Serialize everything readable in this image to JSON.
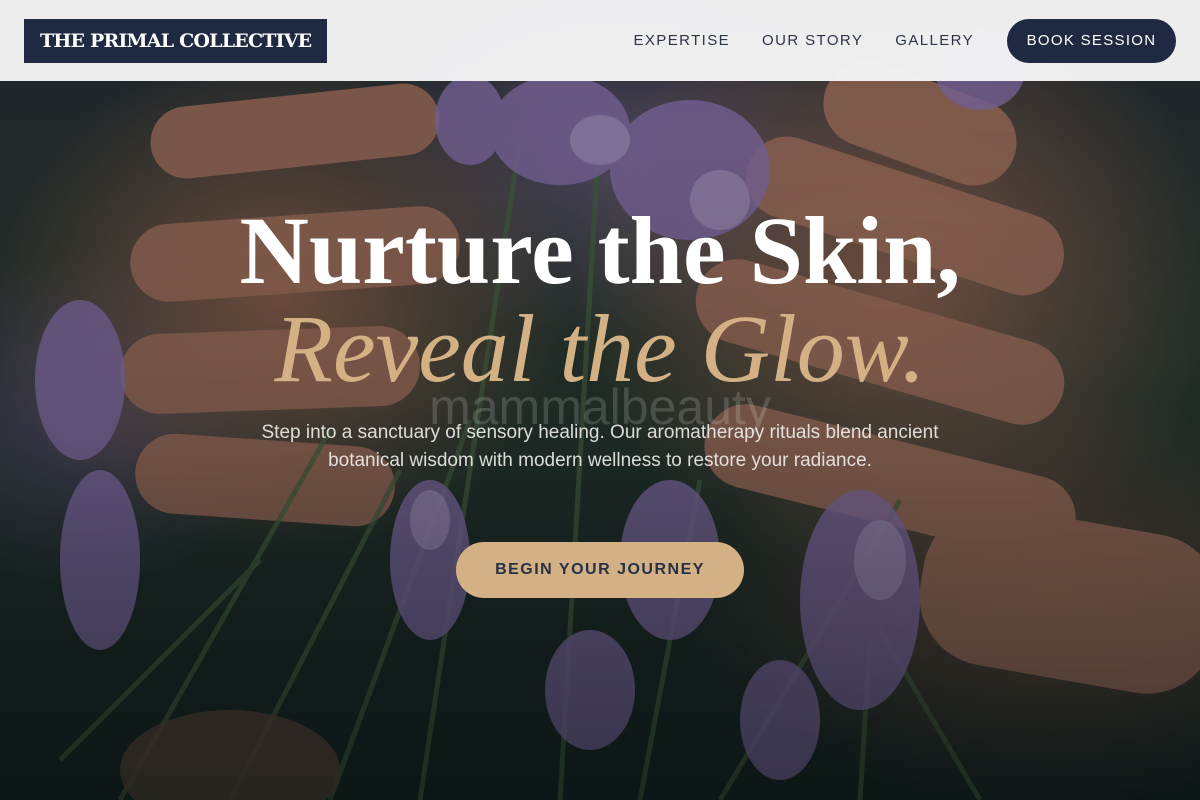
{
  "header": {
    "logo_text": "THE PRIMAL COLLECTIVE",
    "nav": [
      {
        "label": "EXPERTISE"
      },
      {
        "label": "OUR STORY"
      },
      {
        "label": "GALLERY"
      }
    ],
    "book_button": "BOOK SESSION"
  },
  "hero": {
    "headline_line1": "Nurture the Skin,",
    "headline_line2": "Reveal the Glow.",
    "watermark": "mammalbeauty",
    "subtext": "Step into a sanctuary of sensory healing. Our aromatherapy rituals blend ancient botanical wisdom with modern wellness to restore your radiance.",
    "cta_button": "BEGIN YOUR JOURNEY",
    "background_image": "hands-holding-lavender-photo"
  },
  "colors": {
    "navy": "#1f2a42",
    "gold": "#d3b184",
    "header_bg": "#f6f6f7",
    "nav_text": "#2c3446"
  }
}
